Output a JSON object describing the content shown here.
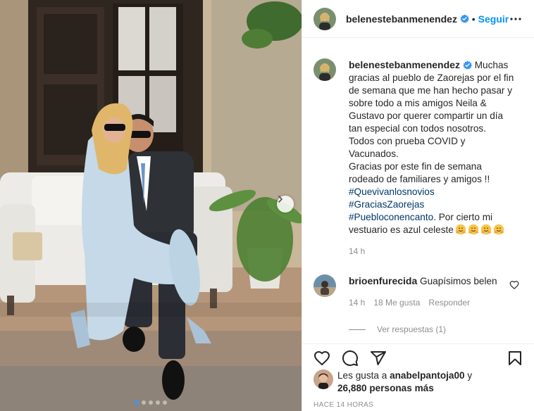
{
  "post": {
    "username": "belenestebanmenendez",
    "separator": "•",
    "follow_label": "Seguir",
    "caption": {
      "text_1": "Muchas gracias al pueblo de Zaorejas por el fin de semana que me han hecho pasar y sobre todo a mis amigos Neila & Gustavo por querer compartir un día tan especial con todos nosotros.",
      "text_2": "Todos con prueba COVID y Vacunados.",
      "text_3": "Gracias por este fin de semana rodeado de familiares y amigos !!",
      "hashtags": [
        "#Quevivanlosnovios",
        "#GraciasZaorejas",
        "#Puebloconencanto"
      ],
      "text_4": ". Por cierto mi vestuario es azul celeste",
      "emoji": "hugging-face",
      "emoji_count": 4,
      "time": "14 h"
    },
    "comment": {
      "username": "brioenfurecida",
      "text": "Guapísimos belen",
      "time": "14 h",
      "likes_label": "18 Me gusta",
      "reply_label": "Responder",
      "view_replies_label": "Ver respuestas (1)"
    },
    "likes": {
      "prefix": "Les gusta a ",
      "first_user": "anabelpantoja00",
      "middle": " y",
      "count_text": "26,880 personas más"
    },
    "time_ago": "HACE 14 HORAS",
    "carousel": {
      "slides": 5,
      "active_index": 0
    }
  },
  "icons": {
    "verified": "verified-badge-icon",
    "more": "more-options-icon",
    "like": "heart-icon",
    "comment": "comment-icon",
    "share": "share-icon",
    "save": "bookmark-icon",
    "next": "chevron-right-icon"
  },
  "colors": {
    "link": "#0095f6",
    "hashtag": "#00376b",
    "muted": "#8e8e8e",
    "active_dot": "#3b97f0"
  }
}
